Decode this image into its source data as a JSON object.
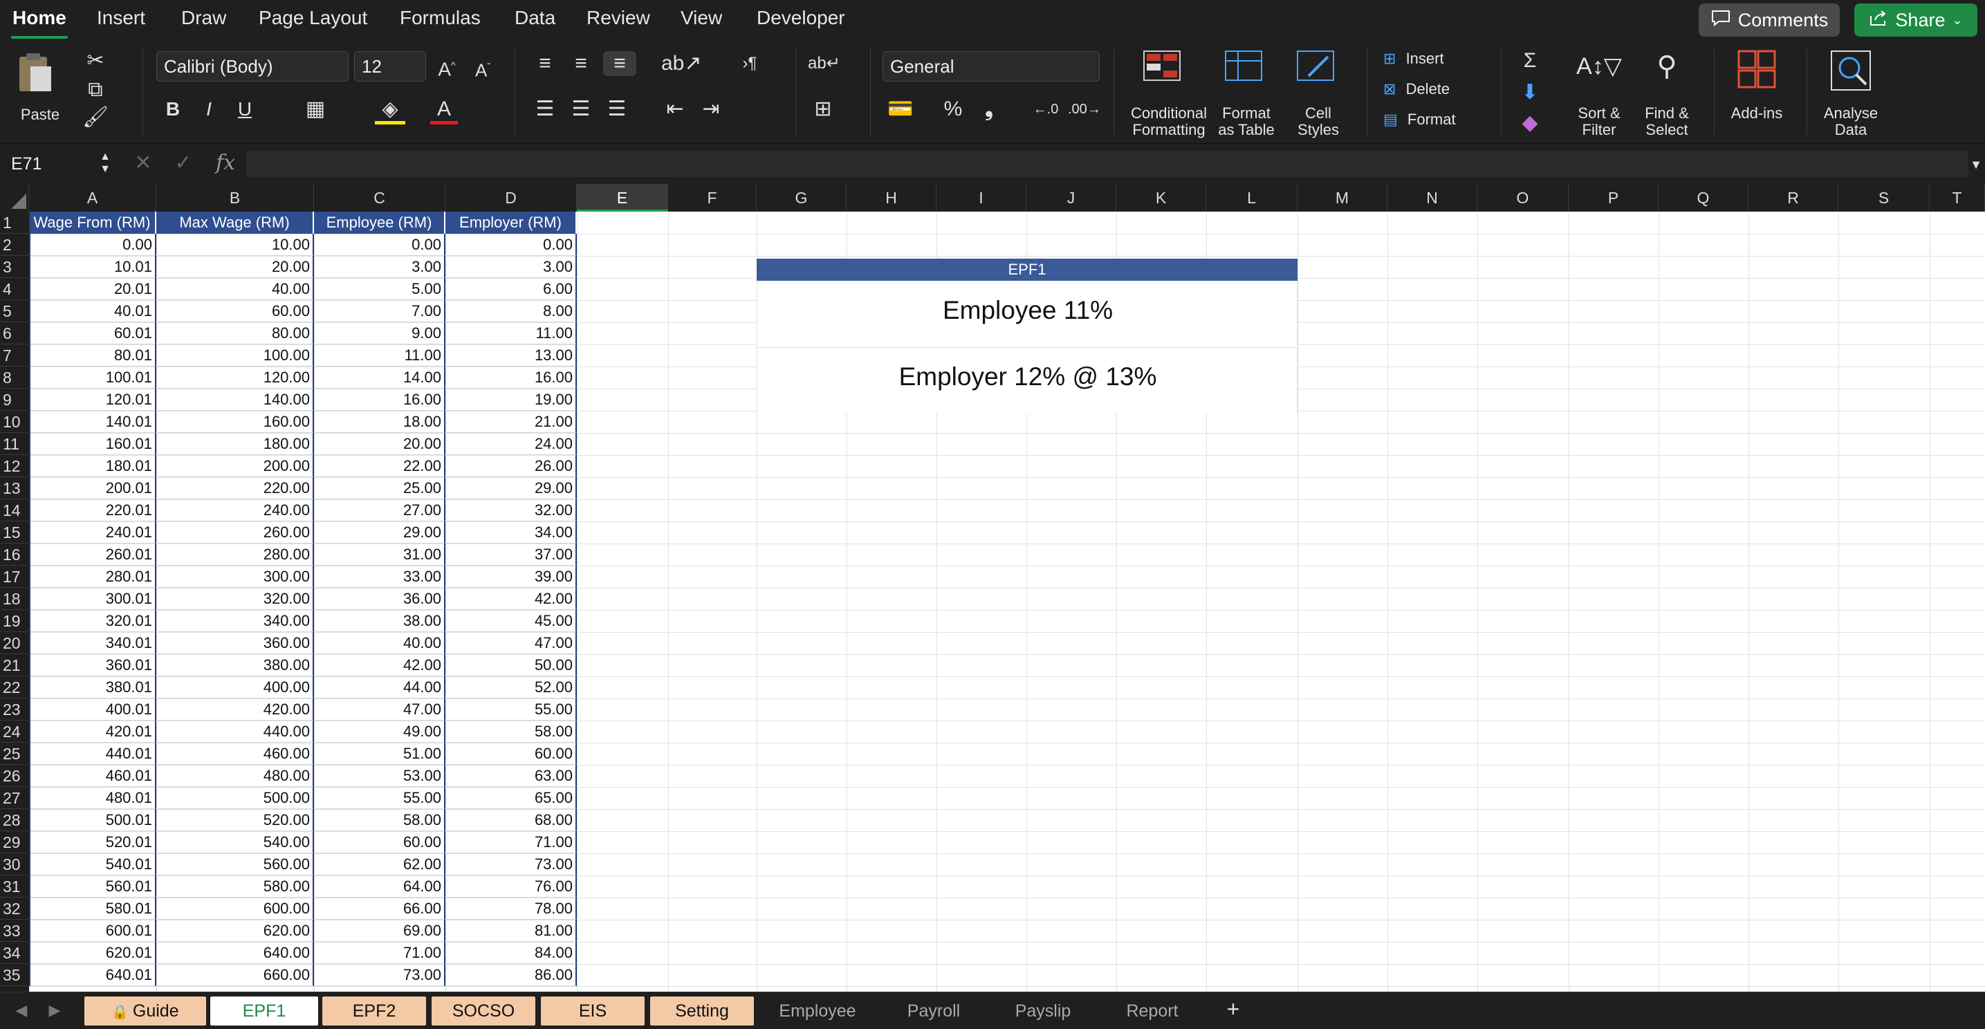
{
  "menu": {
    "tabs": [
      "Home",
      "Insert",
      "Draw",
      "Page Layout",
      "Formulas",
      "Data",
      "Review",
      "View",
      "Developer"
    ],
    "comments_label": "Comments",
    "share_label": "Share"
  },
  "ribbon": {
    "paste_label": "Paste",
    "font_name": "Calibri (Body)",
    "font_size": "12",
    "number_format": "General",
    "conditional_formatting_label": [
      "Conditional",
      "Formatting"
    ],
    "format_as_table_label": [
      "Format",
      "as Table"
    ],
    "cell_styles_label": [
      "Cell",
      "Styles"
    ],
    "insert_label": "Insert",
    "delete_label": "Delete",
    "format_label": "Format",
    "sort_filter_label": [
      "Sort &",
      "Filter"
    ],
    "find_select_label": [
      "Find &",
      "Select"
    ],
    "addins_label": "Add-ins",
    "analyse_data_label": [
      "Analyse",
      "Data"
    ],
    "bold": "B",
    "italic": "I",
    "underline": "U",
    "percent": "%",
    "comma": "❟"
  },
  "formula_bar": {
    "name_box": "E71",
    "formula": ""
  },
  "columns": [
    "A",
    "B",
    "C",
    "D",
    "E",
    "F",
    "G",
    "H",
    "I",
    "J",
    "K",
    "L",
    "M",
    "N",
    "O",
    "P",
    "Q",
    "R",
    "S",
    "T"
  ],
  "selected_column": "E",
  "table": {
    "headers": [
      "Wage From (RM)",
      "Max Wage (RM)",
      "Employee (RM)",
      "Employer (RM)"
    ],
    "rows": [
      [
        "0.00",
        "10.00",
        "0.00",
        "0.00"
      ],
      [
        "10.01",
        "20.00",
        "3.00",
        "3.00"
      ],
      [
        "20.01",
        "40.00",
        "5.00",
        "6.00"
      ],
      [
        "40.01",
        "60.00",
        "7.00",
        "8.00"
      ],
      [
        "60.01",
        "80.00",
        "9.00",
        "11.00"
      ],
      [
        "80.01",
        "100.00",
        "11.00",
        "13.00"
      ],
      [
        "100.01",
        "120.00",
        "14.00",
        "16.00"
      ],
      [
        "120.01",
        "140.00",
        "16.00",
        "19.00"
      ],
      [
        "140.01",
        "160.00",
        "18.00",
        "21.00"
      ],
      [
        "160.01",
        "180.00",
        "20.00",
        "24.00"
      ],
      [
        "180.01",
        "200.00",
        "22.00",
        "26.00"
      ],
      [
        "200.01",
        "220.00",
        "25.00",
        "29.00"
      ],
      [
        "220.01",
        "240.00",
        "27.00",
        "32.00"
      ],
      [
        "240.01",
        "260.00",
        "29.00",
        "34.00"
      ],
      [
        "260.01",
        "280.00",
        "31.00",
        "37.00"
      ],
      [
        "280.01",
        "300.00",
        "33.00",
        "39.00"
      ],
      [
        "300.01",
        "320.00",
        "36.00",
        "42.00"
      ],
      [
        "320.01",
        "340.00",
        "38.00",
        "45.00"
      ],
      [
        "340.01",
        "360.00",
        "40.00",
        "47.00"
      ],
      [
        "360.01",
        "380.00",
        "42.00",
        "50.00"
      ],
      [
        "380.01",
        "400.00",
        "44.00",
        "52.00"
      ],
      [
        "400.01",
        "420.00",
        "47.00",
        "55.00"
      ],
      [
        "420.01",
        "440.00",
        "49.00",
        "58.00"
      ],
      [
        "440.01",
        "460.00",
        "51.00",
        "60.00"
      ],
      [
        "460.01",
        "480.00",
        "53.00",
        "63.00"
      ],
      [
        "480.01",
        "500.00",
        "55.00",
        "65.00"
      ],
      [
        "500.01",
        "520.00",
        "58.00",
        "68.00"
      ],
      [
        "520.01",
        "540.00",
        "60.00",
        "71.00"
      ],
      [
        "540.01",
        "560.00",
        "62.00",
        "73.00"
      ],
      [
        "560.01",
        "580.00",
        "64.00",
        "76.00"
      ],
      [
        "580.01",
        "600.00",
        "66.00",
        "78.00"
      ],
      [
        "600.01",
        "620.00",
        "69.00",
        "81.00"
      ],
      [
        "620.01",
        "640.00",
        "71.00",
        "84.00"
      ],
      [
        "640.01",
        "660.00",
        "73.00",
        "86.00"
      ]
    ]
  },
  "epf_panel": {
    "title": "EPF1",
    "line1": "Employee 11%",
    "line2": "Employer 12% @ 13%"
  },
  "sheet_tabs": [
    {
      "label": "Guide",
      "style": "colored",
      "locked": true
    },
    {
      "label": "EPF1",
      "style": "active"
    },
    {
      "label": "EPF2",
      "style": "colored"
    },
    {
      "label": "SOCSO",
      "style": "colored"
    },
    {
      "label": "EIS",
      "style": "colored"
    },
    {
      "label": "Setting",
      "style": "colored"
    },
    {
      "label": "Employee",
      "style": "plain"
    },
    {
      "label": "Payroll",
      "style": "plain"
    },
    {
      "label": "Payslip",
      "style": "plain"
    },
    {
      "label": "Report",
      "style": "plain"
    }
  ],
  "colors": {
    "accent_green": "#1e9e56",
    "table_header_blue": "#2f4e8f",
    "sheet_tab_peach": "#f3c9a6"
  }
}
